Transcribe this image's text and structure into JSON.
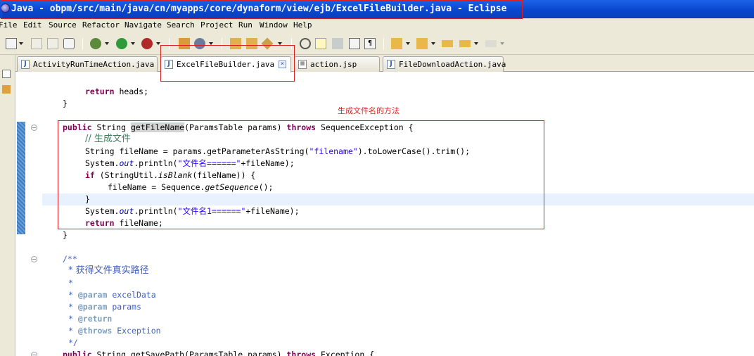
{
  "window": {
    "title": "Java - obpm/src/main/java/cn/myapps/core/dynaform/view/ejb/ExcelFileBuilder.java - Eclipse"
  },
  "menu": [
    "File",
    "Edit",
    "Source",
    "Refactor",
    "Navigate",
    "Search",
    "Project",
    "Run",
    "Window",
    "Help"
  ],
  "tabs": [
    {
      "label": "ActivityRunTimeAction.java",
      "icon": "java-file-icon",
      "active": false
    },
    {
      "label": "ExcelFileBuilder.java",
      "icon": "java-file-icon",
      "active": true
    },
    {
      "label": "action.jsp",
      "icon": "jsp-file-icon",
      "active": false
    },
    {
      "label": "FileDownloadAction.java",
      "icon": "java-file-icon",
      "active": false
    }
  ],
  "annotation": "生成文件名的方法",
  "code": {
    "l01": {
      "kw": "return",
      "rest": " heads;"
    },
    "l02": "}",
    "l03": {
      "kw1": "public",
      "t1": " String ",
      "hl": "getFileName",
      "t2": "(ParamsTable params) ",
      "kw2": "throws",
      "t3": " SequenceException {"
    },
    "l04": {
      "cmt": "// 生成文件"
    },
    "l05": {
      "t1": "String fileName = params.getParameterAsString(",
      "str": "\"filename\"",
      "t2": ").toLowerCase().trim();"
    },
    "l06": {
      "t1": "System.",
      "fld": "out",
      "t2": ".println(",
      "str": "\"文件名======\"",
      "t3": "+fileName);"
    },
    "l07": {
      "kw": "if",
      "t1": " (StringUtil.",
      "it": "isBlank",
      "t2": "(fileName)) {"
    },
    "l08": {
      "t1": "fileName = Sequence.",
      "it": "getSequence",
      "t2": "();"
    },
    "l09": "}",
    "l10": {
      "t1": "System.",
      "fld": "out",
      "t2": ".println(",
      "str": "\"文件名1======\"",
      "t3": "+fileName);"
    },
    "l11": {
      "kw": "return",
      "rest": " fileName;"
    },
    "l12": "}",
    "l13": "/**",
    "l14": "* 获得文件真实路径",
    "l15": "*",
    "l16": {
      "tag": "@param",
      "rest": " excelData"
    },
    "l17": {
      "tag": "@param",
      "rest": " params"
    },
    "l18": {
      "tag": "@return",
      "rest": ""
    },
    "l19": {
      "tag": "@throws",
      "rest": " Exception"
    },
    "l20": "*/",
    "l21": {
      "kw1": "public",
      "t1": " String getSavePath(ParamsTable params) ",
      "kw2": "throws",
      "t2": " Exception {"
    }
  }
}
